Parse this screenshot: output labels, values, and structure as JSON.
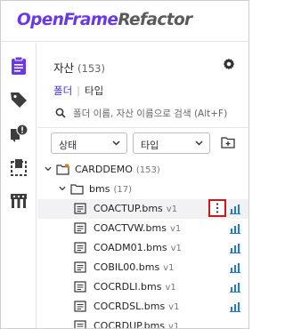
{
  "app": {
    "logo_part1": "OpenFrame",
    "logo_part2": "Refactor"
  },
  "sidebar": {
    "items": [
      {
        "icon": "clipboard-icon",
        "active": true
      },
      {
        "icon": "tag-icon",
        "active": false
      },
      {
        "icon": "alert-icon",
        "active": false
      },
      {
        "icon": "dashed-box-icon",
        "active": false
      },
      {
        "icon": "flow-icon",
        "active": false
      }
    ]
  },
  "panel": {
    "title": "자산",
    "count": "(153)",
    "tabs": {
      "active": "폴더",
      "separator": "|",
      "other": "타입"
    },
    "search": {
      "placeholder": "폴더 이름, 자산 이름으로 검색 (Alt+F)"
    },
    "filters": {
      "status_label": "상태",
      "type_label": "타입"
    }
  },
  "tree": {
    "root": {
      "name": "CARDDEMO",
      "count": "(153)"
    },
    "folder": {
      "name": "bms",
      "count": "(17)"
    },
    "files": [
      {
        "name": "COACTUP.bms",
        "version": "v1"
      },
      {
        "name": "COACTVW.bms",
        "version": "v1"
      },
      {
        "name": "COADM01.bms",
        "version": "v1"
      },
      {
        "name": "COBIL00.bms",
        "version": "v1"
      },
      {
        "name": "COCRDLI.bms",
        "version": "v1"
      },
      {
        "name": "COCRDSL.bms",
        "version": "v1"
      },
      {
        "name": "COCRDUP.bms",
        "version": "v1"
      }
    ]
  },
  "colors": {
    "brand_purple": "#6a39e6",
    "accent_blue": "#1f7ad8",
    "highlight_red": "#d01818"
  }
}
